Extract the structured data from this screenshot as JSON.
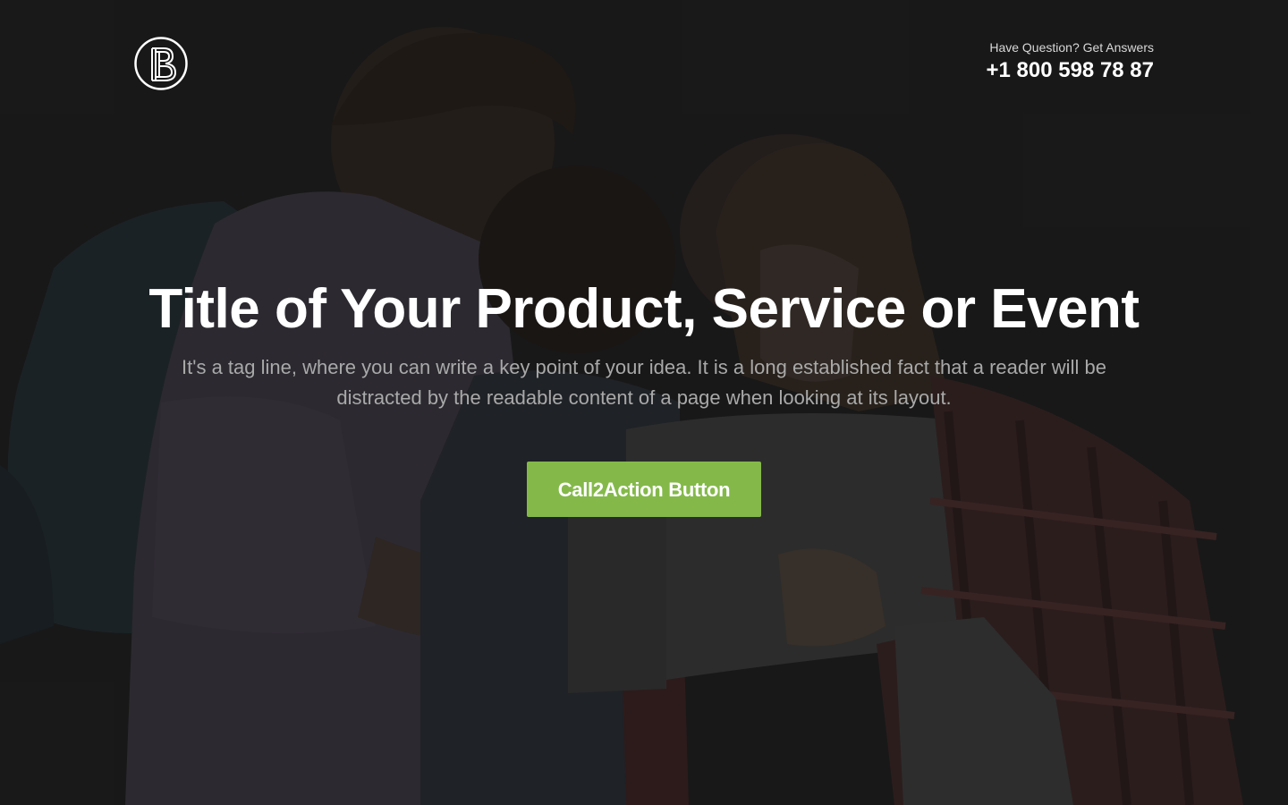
{
  "header": {
    "logo_icon": "b-monogram-logo-icon",
    "contact_caption": "Have Question? Get Answers",
    "contact_phone": "+1 800 598 78 87"
  },
  "hero": {
    "title": "Title of Your Product, Service or Event",
    "tagline": "It's a tag line, where you can write a key point of your idea. It is a long established fact that a reader will be distracted by the readable content of a page when looking at its layout.",
    "cta_label": "Call2Action Button",
    "background_image": "students-looking-at-laptop-photo"
  },
  "colors": {
    "background": "#1b1b1b",
    "accent": "#84b94a",
    "title": "#ffffff",
    "tagline": "#a9a9a9"
  }
}
